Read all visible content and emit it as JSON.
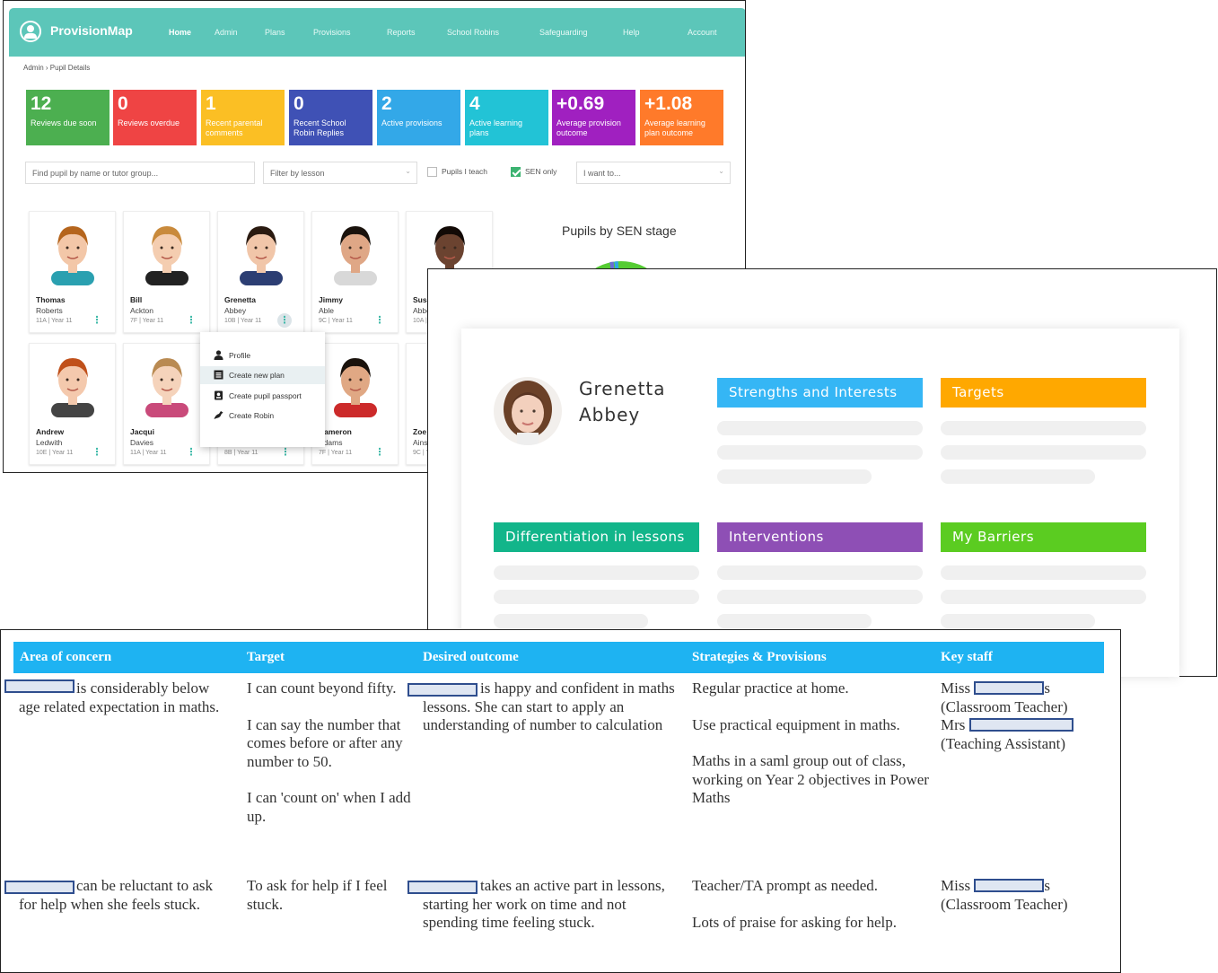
{
  "app": {
    "brand": "ProvisionMap"
  },
  "nav": {
    "items": [
      "Home",
      "Admin",
      "Plans",
      "Provisions",
      "Reports",
      "School Robins",
      "Safeguarding",
      "Help",
      "Account"
    ]
  },
  "breadcrumb": "Admin › Pupil Details",
  "stats": [
    {
      "num": "12",
      "label": "Reviews due soon",
      "color": "#4caf50"
    },
    {
      "num": "0",
      "label": "Reviews overdue",
      "color": "#ef4444"
    },
    {
      "num": "1",
      "label": "Recent parental comments",
      "color": "#fbbf24"
    },
    {
      "num": "0",
      "label": "Recent School Robin Replies",
      "color": "#3f51b5"
    },
    {
      "num": "2",
      "label": "Active provisions",
      "color": "#33a8e8"
    },
    {
      "num": "4",
      "label": "Active learning plans",
      "color": "#22c3d6"
    },
    {
      "num": "+0.69",
      "label": "Average provision outcome",
      "color": "#a020c0"
    },
    {
      "num": "+1.08",
      "label": "Average learning plan outcome",
      "color": "#ff7a2a"
    }
  ],
  "filters": {
    "search_placeholder": "Find pupil by name or tutor group...",
    "lesson_placeholder": "Filter by lesson",
    "pupils_i_teach": {
      "label": "Pupils I teach",
      "checked": false
    },
    "sen_only": {
      "label": "SEN only",
      "checked": true
    },
    "action_placeholder": "I want to..."
  },
  "pupils": [
    {
      "first": "Thomas",
      "last": "Roberts",
      "meta": "11A | Year 11"
    },
    {
      "first": "Bill",
      "last": "Ackton",
      "meta": "7F | Year 11"
    },
    {
      "first": "Grenetta",
      "last": "Abbey",
      "meta": "10B | Year 11"
    },
    {
      "first": "Jimmy",
      "last": "Able",
      "meta": "9C | Year 11"
    },
    {
      "first": "Susan",
      "last": "Abbot",
      "meta": "10A | Year 11"
    },
    {
      "first": "Andrew",
      "last": "Ledwith",
      "meta": "10E | Year 11"
    },
    {
      "first": "Jacqui",
      "last": "Davies",
      "meta": "11A | Year 11"
    },
    {
      "first": "",
      "last": "",
      "meta": "8B | Year 11"
    },
    {
      "first": "Cameron",
      "last": "Adams",
      "meta": "7F | Year 11"
    },
    {
      "first": "Zoe",
      "last": "Ainsworth",
      "meta": "9C | Year 11"
    }
  ],
  "context_menu": [
    "Profile",
    "Create new plan",
    "Create pupil passport",
    "Create Robin"
  ],
  "sen_chart": {
    "title": "Pupils by SEN stage",
    "ring_color": "#55cc33"
  },
  "profile": {
    "first_name": "Grenetta",
    "last_name": "Abbey",
    "tiles": [
      {
        "title": "Strengths and Interests",
        "color": "#35b6f5"
      },
      {
        "title": "Targets",
        "color": "#ffa800"
      },
      {
        "title": "Differentiation in lessons",
        "color": "#12b58a"
      },
      {
        "title": "Interventions",
        "color": "#8e4fb5"
      },
      {
        "title": "My Barriers",
        "color": "#5bcc21"
      }
    ]
  },
  "plan_table": {
    "headers": [
      "Area of concern",
      "Target",
      "Desired outcome",
      "Strategies & Provisions",
      "Key staff"
    ],
    "rows": [
      {
        "concern": "is considerably below age related expectation in maths.",
        "targets": [
          "I can count beyond fifty.",
          "I can say the number that comes before or after any number to 50.",
          "I can 'count on' when I add up."
        ],
        "outcome": "is happy and confident in maths lessons. She can start to apply an understanding of number to calculation",
        "strategies": [
          "Regular practice at home.",
          "Use practical equipment in maths.",
          "Maths in a saml group out of class, working on Year 2 objectives in Power Maths"
        ],
        "staff": [
          {
            "prefix": "Miss",
            "suffix": "s",
            "role": "(Classroom Teacher)"
          },
          {
            "prefix": "Mrs",
            "suffix": "",
            "role": "(Teaching Assistant)"
          }
        ]
      },
      {
        "concern": "can be reluctant to ask for help when she feels stuck.",
        "targets": [
          "To ask for help if I feel stuck."
        ],
        "outcome": "takes an active part in lessons, starting her work on time and not spending time feeling stuck.",
        "strategies": [
          "Teacher/TA prompt as needed.",
          "Lots of praise for asking for help."
        ],
        "staff": [
          {
            "prefix": "Miss",
            "suffix": "s",
            "role": "(Classroom Teacher)"
          }
        ]
      }
    ]
  }
}
